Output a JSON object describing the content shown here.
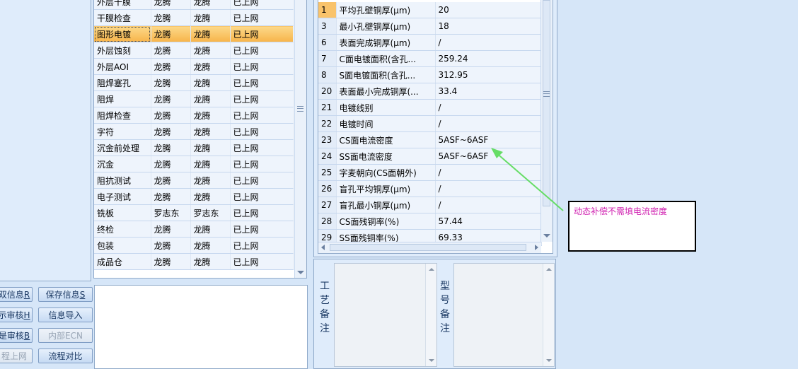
{
  "process_table": {
    "rows": [
      {
        "step": "外层干膜",
        "op1": "龙腾",
        "op2": "龙腾",
        "status": "已上网"
      },
      {
        "step": "干膜检查",
        "op1": "龙腾",
        "op2": "龙腾",
        "status": "已上网"
      },
      {
        "step": "图形电镀",
        "op1": "龙腾",
        "op2": "龙腾",
        "status": "已上网"
      },
      {
        "step": "外层蚀刻",
        "op1": "龙腾",
        "op2": "龙腾",
        "status": "已上网"
      },
      {
        "step": "外层AOI",
        "op1": "龙腾",
        "op2": "龙腾",
        "status": "已上网"
      },
      {
        "step": "阻焊塞孔",
        "op1": "龙腾",
        "op2": "龙腾",
        "status": "已上网"
      },
      {
        "step": "阻焊",
        "op1": "龙腾",
        "op2": "龙腾",
        "status": "已上网"
      },
      {
        "step": "阻焊检查",
        "op1": "龙腾",
        "op2": "龙腾",
        "status": "已上网"
      },
      {
        "step": "字符",
        "op1": "龙腾",
        "op2": "龙腾",
        "status": "已上网"
      },
      {
        "step": "沉金前处理",
        "op1": "龙腾",
        "op2": "龙腾",
        "status": "已上网"
      },
      {
        "step": "沉金",
        "op1": "龙腾",
        "op2": "龙腾",
        "status": "已上网"
      },
      {
        "step": "阻抗测试",
        "op1": "龙腾",
        "op2": "龙腾",
        "status": "已上网"
      },
      {
        "step": "电子测试",
        "op1": "龙腾",
        "op2": "龙腾",
        "status": "已上网"
      },
      {
        "step": "铣板",
        "op1": "罗志东",
        "op2": "罗志东",
        "status": "已上网"
      },
      {
        "step": "终检",
        "op1": "龙腾",
        "op2": "龙腾",
        "status": "已上网"
      },
      {
        "step": "包装",
        "op1": "龙腾",
        "op2": "龙腾",
        "status": "已上网"
      },
      {
        "step": "成品仓",
        "op1": "龙腾",
        "op2": "龙腾",
        "status": "已上网"
      }
    ],
    "selected_index": 2
  },
  "buttons": {
    "info": {
      "label": "双信息",
      "key": "R"
    },
    "save_info": {
      "label": "保存信息",
      "key": "S"
    },
    "audit": {
      "label": "示审核",
      "key": "H"
    },
    "import_info": {
      "label": "信息导入"
    },
    "re_audit": {
      "label": "是审核",
      "key": "B"
    },
    "internal_ecn": {
      "label": "内部ECN"
    },
    "online": {
      "label": "程上网"
    },
    "flow_compare": {
      "label": "流程对比"
    }
  },
  "param_table": {
    "rows": [
      {
        "no": "1",
        "name": "平均孔壁铜厚(μm)",
        "value": "20"
      },
      {
        "no": "3",
        "name": "最小孔壁铜厚(μm)",
        "value": "18"
      },
      {
        "no": "6",
        "name": "表面完成铜厚(μm)",
        "value": "/"
      },
      {
        "no": "7",
        "name": "C面电镀面积(含孔...",
        "value": "259.24"
      },
      {
        "no": "8",
        "name": "S面电镀面积(含孔...",
        "value": "312.95"
      },
      {
        "no": "20",
        "name": "表面最小完成铜厚(...",
        "value": "33.4"
      },
      {
        "no": "21",
        "name": "电镀线别",
        "value": "/"
      },
      {
        "no": "22",
        "name": "电镀时间",
        "value": "/"
      },
      {
        "no": "23",
        "name": "CS面电流密度",
        "value": "5ASF~6ASF"
      },
      {
        "no": "24",
        "name": "SS面电流密度",
        "value": "5ASF~6ASF"
      },
      {
        "no": "25",
        "name": "字麦朝向(CS面朝外)",
        "value": "/"
      },
      {
        "no": "26",
        "name": "盲孔平均铜厚(μm)",
        "value": "/"
      },
      {
        "no": "27",
        "name": "盲孔最小铜厚(μm)",
        "value": "/"
      },
      {
        "no": "28",
        "name": "CS面残铜率(%)",
        "value": "57.44"
      },
      {
        "no": "29",
        "name": "SS面残铜率(%)",
        "value": "69.33"
      }
    ]
  },
  "memo": {
    "process_label": "工艺备注",
    "model_label": "型号备注",
    "process_text": "",
    "model_text": ""
  },
  "annotation": {
    "text": "动态补偿不需填电流密度",
    "arrow_color": "#66dd66",
    "text_color": "#d020b0"
  }
}
